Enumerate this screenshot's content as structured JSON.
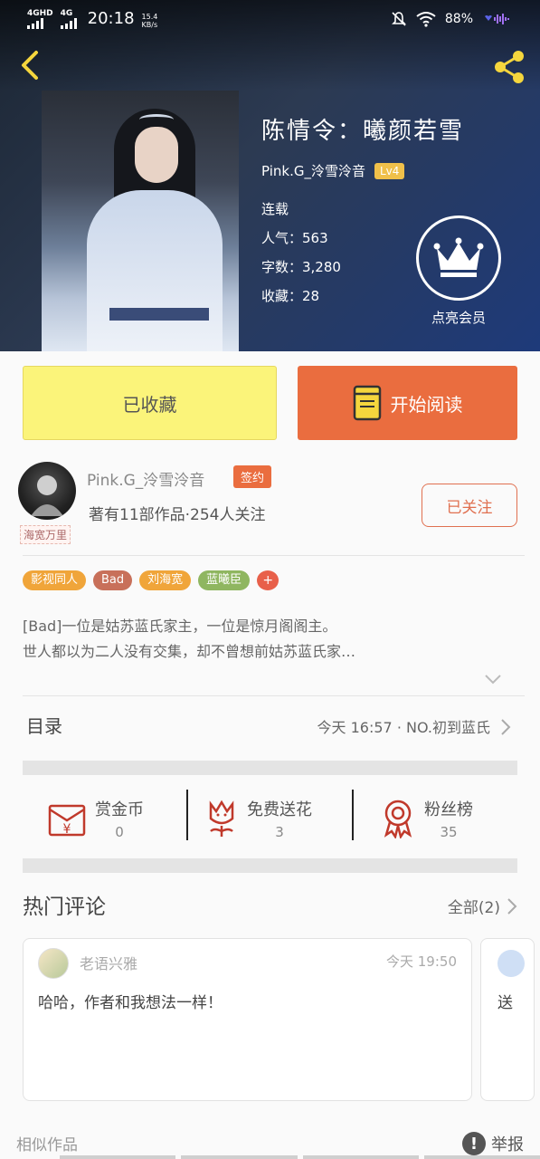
{
  "status_bar": {
    "sig1_label": "4GHD",
    "sig2_label": "4G",
    "time": "20:18",
    "net_speed_value": "15.4",
    "net_speed_unit": "KB/s",
    "battery": "88%"
  },
  "book": {
    "title": "陈情令：曦颜若雪",
    "author": "Pink.G_泠雪泠音",
    "level": "Lv4",
    "status": "连载",
    "popularity": "人气：563",
    "word_count": "字数：3,280",
    "favorites": "收藏：28",
    "vip_label": "点亮会员"
  },
  "actions": {
    "favorited_label": "已收藏",
    "read_label": "开始阅读"
  },
  "author_card": {
    "name": "Pink.G_泠雪泠音",
    "sign_badge": "签约",
    "works": "著有11部作品·254人关注",
    "follow_label": "已关注",
    "avatar_tag": "海宽万里"
  },
  "tags": [
    {
      "label": "影视同人",
      "color": "#f0a53a"
    },
    {
      "label": "Bad",
      "color": "#c8705a"
    },
    {
      "label": "刘海宽",
      "color": "#f0a53a"
    },
    {
      "label": "蓝曦臣",
      "color": "#8fb660"
    }
  ],
  "tag_add_label": "+",
  "synopsis": {
    "line1": "[Bad]一位是姑苏蓝氏家主，一位是惊月阁阁主。",
    "line2": "世人都以为二人没有交集，却不曾想前姑苏蓝氏家…"
  },
  "toc": {
    "title": "目录",
    "latest": "今天 16:57 · NO.初到蓝氏"
  },
  "rewards": {
    "coin_label": "赏金币",
    "coin_count": "0",
    "flower_label": "免费送花",
    "flower_count": "3",
    "fans_label": "粉丝榜",
    "fans_count": "35"
  },
  "comments": {
    "title": "热门评论",
    "all_label": "全部(2)",
    "items": [
      {
        "user": "老语兴雅",
        "time": "今天 19:50",
        "text": "哈哈，作者和我想法一样！"
      },
      {
        "text": "送"
      }
    ]
  },
  "footer": {
    "similar_label": "相似作品",
    "report_label": "举报",
    "report_icon": "!"
  },
  "colors": {
    "accent_orange": "#ea6d3f",
    "fav_yellow": "#fbf47a",
    "level_gold": "#f0c04a"
  }
}
